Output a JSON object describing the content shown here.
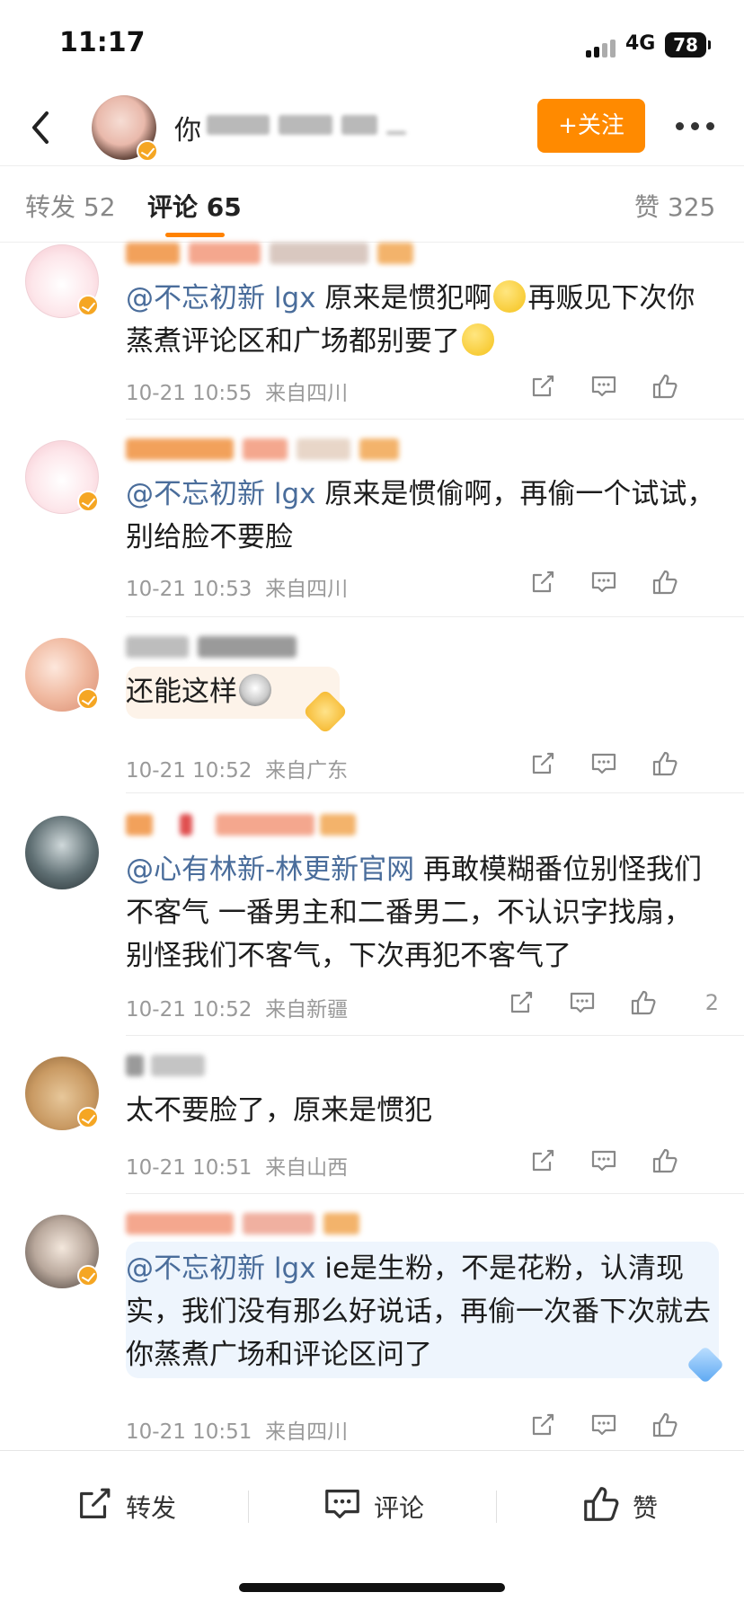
{
  "status_bar": {
    "time": "11:17",
    "network": "4G",
    "battery": "78"
  },
  "nav": {
    "back_icon": "chevron-left-icon",
    "user_name_visible": "你",
    "follow_label": "+关注",
    "more_icon": "more-dots-icon"
  },
  "tabs": {
    "repost": "转发 52",
    "comment": "评论 65",
    "like": "赞 325"
  },
  "comments": [
    {
      "mention": "@不忘初新 lgx",
      "text_a": " 原来是惯犯啊",
      "text_b": "再贩见下次你蒸煮评论区和广场都别要了",
      "time": "10-21 10:55",
      "location": "来自四川",
      "likes": ""
    },
    {
      "mention": "@不忘初新 lgx",
      "text_a": " 原来是惯偷啊，再偷一个试试，别给脸不要脸",
      "time": "10-21 10:53",
      "location": "来自四川",
      "likes": ""
    },
    {
      "mention": "",
      "text_a": "还能这样",
      "time": "10-21 10:52",
      "location": "来自广东",
      "likes": ""
    },
    {
      "mention": "@心有林新-林更新官网",
      "text_a": " 再敢模糊番位别怪我们不客气 一番男主和二番男二，不认识字找扇，别怪我们不客气，下次再犯不客气了",
      "time": "10-21 10:52",
      "location": "来自新疆",
      "likes": "2"
    },
    {
      "mention": "",
      "text_a": "太不要脸了，原来是惯犯",
      "time": "10-21 10:51",
      "location": "来自山西",
      "likes": ""
    },
    {
      "mention": "@不忘初新 lgx",
      "text_a": " ie是生粉，不是花粉，认清现实，我们没有那么好说话，再偷一次番下次就去你蒸煮广场和评论区问了",
      "time": "10-21 10:51",
      "location": "来自四川",
      "likes": ""
    }
  ],
  "bottom_bar": {
    "repost": "转发",
    "comment": "评论",
    "like": "赞"
  },
  "colors": {
    "accent": "#ff8200",
    "follow_button": "#ff8a00",
    "mention": "#4a6d9b",
    "meta": "#999999",
    "verified_badge": "#f5a623"
  },
  "icons": [
    "share-icon",
    "comment-icon",
    "thumbs-up-icon",
    "verified-badge-icon"
  ]
}
